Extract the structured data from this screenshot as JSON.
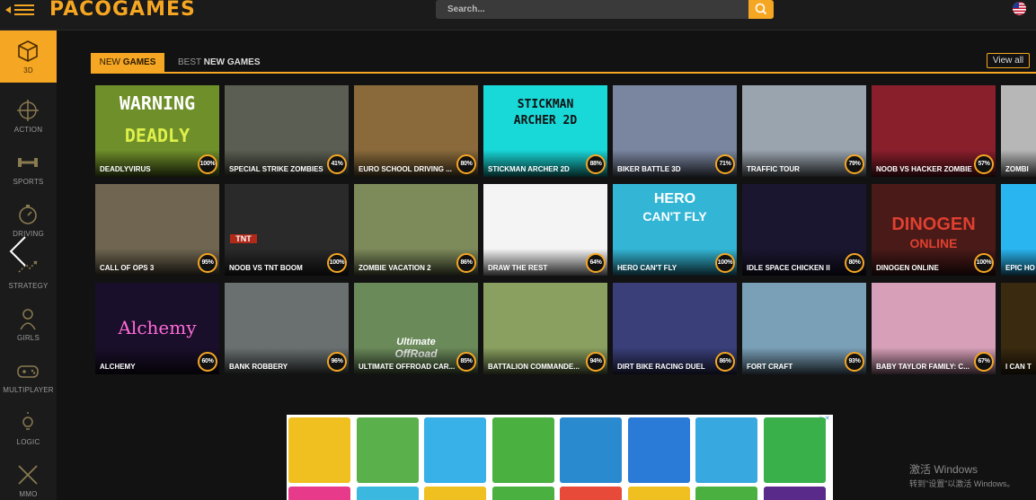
{
  "header": {
    "logo": "PACOGAMES",
    "search_placeholder": "Search...",
    "flag": "us-flag-icon"
  },
  "sidebar": {
    "items": [
      {
        "label": "3D",
        "icon": "cube-icon",
        "active": true
      },
      {
        "label": "ACTION",
        "icon": "crosshair-icon",
        "active": false
      },
      {
        "label": "SPORTS",
        "icon": "dumbbell-icon",
        "active": false
      },
      {
        "label": "DRIVING",
        "icon": "stopwatch-icon",
        "active": false
      },
      {
        "label": "STRATEGY",
        "icon": "strategy-icon",
        "active": false
      },
      {
        "label": "GIRLS",
        "icon": "girl-icon",
        "active": false
      },
      {
        "label": "MULTIPLAYER",
        "icon": "gamepad-icon",
        "active": false
      },
      {
        "label": "LOGIC",
        "icon": "bulb-icon",
        "active": false
      },
      {
        "label": "MMO",
        "icon": "swords-icon",
        "active": false
      }
    ]
  },
  "tabs": {
    "new_prefix": "NEW ",
    "new_hl": "GAMES",
    "best_prefix": "BEST ",
    "best_hl": "NEW GAMES",
    "view_all": "View all"
  },
  "games": [
    [
      {
        "title": "DEADLYVIRUS",
        "rating": "100%",
        "color": "#6f8f2a"
      },
      {
        "title": "SPECIAL STRIKE ZOMBIES",
        "rating": "41%",
        "color": "#5b5e52"
      },
      {
        "title": "EURO SCHOOL DRIVING ...",
        "rating": "80%",
        "color": "#8a6a3b"
      },
      {
        "title": "STICKMAN ARCHER 2D",
        "rating": "88%",
        "color": "#19d8d8"
      },
      {
        "title": "BIKER BATTLE 3D",
        "rating": "71%",
        "color": "#7a86a0"
      },
      {
        "title": "TRAFFIC TOUR",
        "rating": "79%",
        "color": "#9aa4ae"
      },
      {
        "title": "NOOB VS HACKER ZOMBIE",
        "rating": "57%",
        "color": "#8a1f2c"
      },
      {
        "title": "ZOMBI",
        "rating": "",
        "color": "#b7b7b7"
      }
    ],
    [
      {
        "title": "CALL OF OPS 3",
        "rating": "95%",
        "color": "#6f6550"
      },
      {
        "title": "NOOB VS TNT BOOM",
        "rating": "100%",
        "color": "#2a2a2a"
      },
      {
        "title": "ZOMBIE VACATION 2",
        "rating": "86%",
        "color": "#7d8a5a"
      },
      {
        "title": "DRAW THE REST",
        "rating": "64%",
        "color": "#f4f4f4"
      },
      {
        "title": "HERO CAN'T FLY",
        "rating": "100%",
        "color": "#33b6d6"
      },
      {
        "title": "IDLE SPACE CHICKEN II",
        "rating": "80%",
        "color": "#1b1630"
      },
      {
        "title": "DINOGEN ONLINE",
        "rating": "100%",
        "color": "#4a1a18"
      },
      {
        "title": "EPIC HO",
        "rating": "",
        "color": "#29b6f0"
      }
    ],
    [
      {
        "title": "ALCHEMY",
        "rating": "60%",
        "color": "#1a0f2a"
      },
      {
        "title": "BANK ROBBERY",
        "rating": "96%",
        "color": "#6a7070"
      },
      {
        "title": "ULTIMATE OFFROAD CAR...",
        "rating": "85%",
        "color": "#6a8a5a"
      },
      {
        "title": "BATTALION COMMANDE...",
        "rating": "94%",
        "color": "#8aa060"
      },
      {
        "title": "DIRT BIKE RACING DUEL",
        "rating": "86%",
        "color": "#3a3f7a"
      },
      {
        "title": "FORT CRAFT",
        "rating": "93%",
        "color": "#7aa0b8"
      },
      {
        "title": "BABY TAYLOR FAMILY: C...",
        "rating": "67%",
        "color": "#d7a0b8"
      },
      {
        "title": "I CAN T",
        "rating": "",
        "color": "#3a2a10"
      }
    ]
  ],
  "art": {
    "deadly_line1": "WARNING",
    "deadly_line2": "DEADLY",
    "stickman_line1": "STICKMAN",
    "stickman_line2": "ARCHER 2D",
    "hero_line1": "HERO",
    "hero_line2": "CAN'T FLY",
    "dinogen_line1": "DINOGEN",
    "dinogen_line2": "ONLINE",
    "alchemy": "Alchemy",
    "offroad_line1": "Ultimate",
    "offroad_line2": "OffRoad",
    "tnt": "TNT"
  },
  "ad": {
    "badge": "▷✕",
    "tiles": [
      "#f0c020",
      "#5ab04a",
      "#38b0e8",
      "#4ab040",
      "#2a8ad0",
      "#2a7ad8",
      "#38a8e0",
      "#3ab04a"
    ],
    "tiles_bottom": [
      "#e83a8a",
      "#3ab8e0",
      "#f0c020",
      "#4ab040",
      "#e84a3a",
      "#f0c020",
      "#4ab040",
      "#5a2a8a"
    ]
  },
  "watermark": {
    "line1": "激活 Windows",
    "line2": "转到\"设置\"以激活 Windows。"
  }
}
